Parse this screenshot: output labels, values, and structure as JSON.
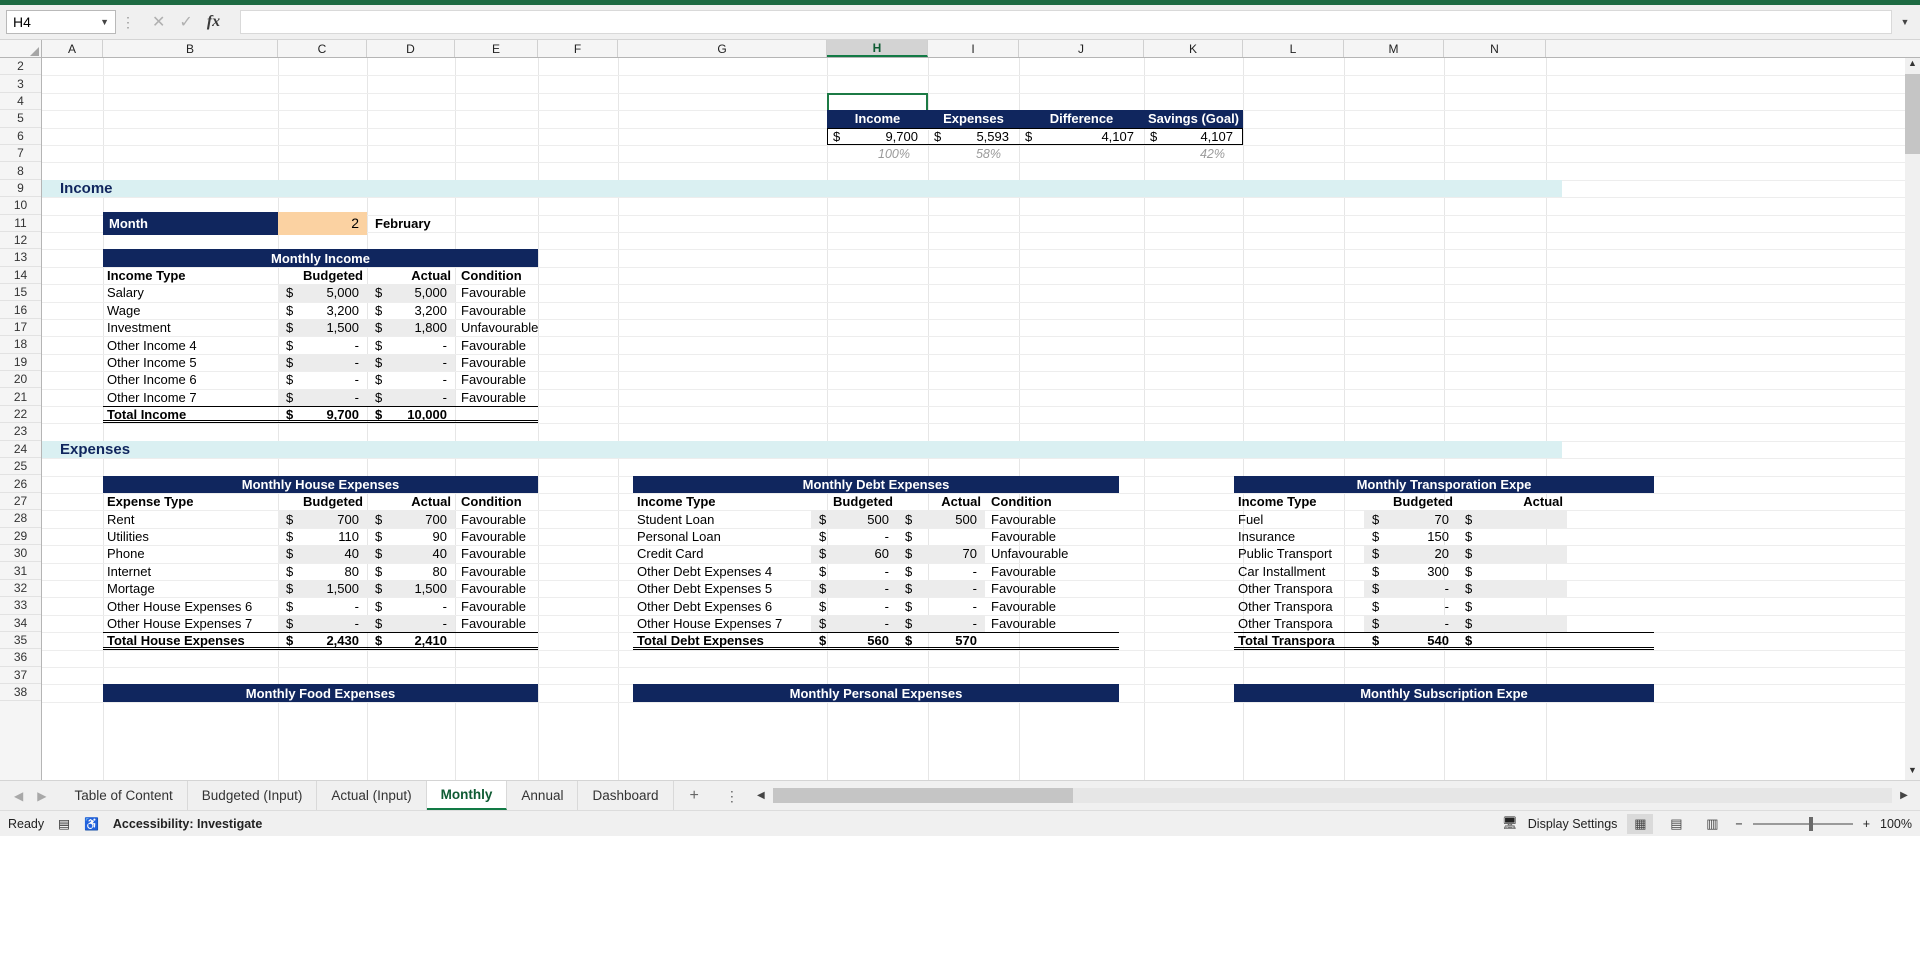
{
  "app": {
    "namebox_value": "H4",
    "formula_value": "",
    "icons": {
      "cancel": "cancel-icon",
      "confirm": "confirm-icon",
      "fx": "fx-icon"
    }
  },
  "columns": [
    "A",
    "B",
    "C",
    "D",
    "E",
    "F",
    "G",
    "H",
    "I",
    "J",
    "K",
    "L",
    "M",
    "N"
  ],
  "selected_column": "H",
  "rows": [
    "2",
    "3",
    "4",
    "5",
    "6",
    "7",
    "8",
    "9",
    "10",
    "11",
    "12",
    "13",
    "14",
    "15",
    "16",
    "17",
    "18",
    "19",
    "20",
    "21",
    "22",
    "23",
    "24",
    "25",
    "26",
    "27",
    "28",
    "29",
    "30",
    "31",
    "32",
    "33",
    "34",
    "35",
    "36",
    "37",
    "38"
  ],
  "summary": {
    "headers": [
      "Income",
      "Expenses",
      "Difference",
      "Savings (Goal)"
    ],
    "currency": "$",
    "values": [
      "9,700",
      "5,593",
      "4,107",
      "4,107"
    ],
    "percents": [
      "100%",
      "58%",
      "",
      "42%"
    ]
  },
  "sections": {
    "income": "Income",
    "expenses": "Expenses"
  },
  "month_selector": {
    "label": "Month",
    "value": "2",
    "name": "February"
  },
  "tables": {
    "monthly_income": {
      "title": "Monthly Income",
      "headers": [
        "Income Type",
        "Budgeted",
        "Actual",
        "Condition"
      ],
      "rows": [
        {
          "type": "Salary",
          "budget": "5,000",
          "actual": "5,000",
          "condition": "Favourable"
        },
        {
          "type": "Wage",
          "budget": "3,200",
          "actual": "3,200",
          "condition": "Favourable"
        },
        {
          "type": "Investment",
          "budget": "1,500",
          "actual": "1,800",
          "condition": "Unfavourable"
        },
        {
          "type": "Other Income 4",
          "budget": "-",
          "actual": "-",
          "condition": "Favourable"
        },
        {
          "type": "Other Income 5",
          "budget": "-",
          "actual": "-",
          "condition": "Favourable"
        },
        {
          "type": "Other Income 6",
          "budget": "-",
          "actual": "-",
          "condition": "Favourable"
        },
        {
          "type": "Other Income 7",
          "budget": "-",
          "actual": "-",
          "condition": "Favourable"
        }
      ],
      "total": {
        "label": "Total Income",
        "budget": "9,700",
        "actual": "10,000"
      }
    },
    "house_expenses": {
      "title": "Monthly House Expenses",
      "headers": [
        "Expense Type",
        "Budgeted",
        "Actual",
        "Condition"
      ],
      "rows": [
        {
          "type": "Rent",
          "budget": "700",
          "actual": "700",
          "condition": "Favourable"
        },
        {
          "type": "Utilities",
          "budget": "110",
          "actual": "90",
          "condition": "Favourable"
        },
        {
          "type": "Phone",
          "budget": "40",
          "actual": "40",
          "condition": "Favourable"
        },
        {
          "type": "Internet",
          "budget": "80",
          "actual": "80",
          "condition": "Favourable"
        },
        {
          "type": "Mortage",
          "budget": "1,500",
          "actual": "1,500",
          "condition": "Favourable"
        },
        {
          "type": "Other House Expenses 6",
          "budget": "-",
          "actual": "-",
          "condition": "Favourable"
        },
        {
          "type": "Other House Expenses 7",
          "budget": "-",
          "actual": "-",
          "condition": "Favourable"
        }
      ],
      "total": {
        "label": "Total House Expenses",
        "budget": "2,430",
        "actual": "2,410"
      }
    },
    "debt_expenses": {
      "title": "Monthly Debt Expenses",
      "headers": [
        "Income Type",
        "Budgeted",
        "Actual",
        "Condition"
      ],
      "rows": [
        {
          "type": "Student Loan",
          "budget": "500",
          "actual": "500",
          "condition": "Favourable"
        },
        {
          "type": "Personal Loan",
          "budget": "-",
          "actual": "",
          "condition": "Favourable"
        },
        {
          "type": "Credit Card",
          "budget": "60",
          "actual": "70",
          "condition": "Unfavourable"
        },
        {
          "type": "Other Debt Expenses 4",
          "budget": "-",
          "actual": "-",
          "condition": "Favourable"
        },
        {
          "type": "Other Debt Expenses 5",
          "budget": "-",
          "actual": "-",
          "condition": "Favourable"
        },
        {
          "type": "Other Debt Expenses 6",
          "budget": "-",
          "actual": "-",
          "condition": "Favourable"
        },
        {
          "type": "Other House Expenses 7",
          "budget": "-",
          "actual": "-",
          "condition": "Favourable"
        }
      ],
      "total": {
        "label": "Total Debt Expenses",
        "budget": "560",
        "actual": "570"
      }
    },
    "transportation_expenses": {
      "title": "Monthly Transporation Expe",
      "headers": [
        "Income Type",
        "Budgeted",
        "Actual"
      ],
      "rows": [
        {
          "type": "Fuel",
          "budget": "70",
          "actual": ""
        },
        {
          "type": "Insurance",
          "budget": "150",
          "actual": ""
        },
        {
          "type": "Public Transport",
          "budget": "20",
          "actual": ""
        },
        {
          "type": "Car Installment",
          "budget": "300",
          "actual": ""
        },
        {
          "type": "Other Transpora",
          "budget": "-",
          "actual": ""
        },
        {
          "type": "Other Transpora",
          "budget": "-",
          "actual": ""
        },
        {
          "type": "Other Transpora",
          "budget": "-",
          "actual": ""
        }
      ],
      "total": {
        "label": "Total Transpora",
        "budget": "540",
        "actual": ""
      }
    },
    "partial_bottom": {
      "food": "Monthly Food Expenses",
      "personal": "Monthly Personal Expenses",
      "subscription": "Monthly Subscription Expe"
    }
  },
  "sheet_tabs": {
    "items": [
      {
        "label": "Table of Content",
        "active": false
      },
      {
        "label": "Budgeted (Input)",
        "active": false
      },
      {
        "label": "Actual (Input)",
        "active": false
      },
      {
        "label": "Monthly",
        "active": true
      },
      {
        "label": "Annual",
        "active": false
      },
      {
        "label": "Dashboard",
        "active": false
      }
    ],
    "add_label": "+"
  },
  "status_bar": {
    "ready": "Ready",
    "accessibility": "Accessibility: Investigate",
    "display_settings": "Display Settings",
    "zoom": "100%",
    "zoom_out": "−",
    "zoom_in": "+"
  }
}
